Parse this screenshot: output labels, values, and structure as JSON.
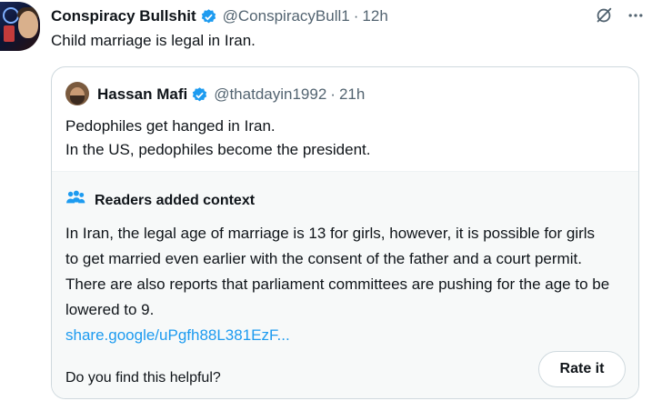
{
  "tweet": {
    "author_name": "Conspiracy Bullshit",
    "author_handle": "@ConspiracyBull1",
    "separator": "·",
    "time": "12h",
    "text": "Child marriage is legal in Iran.",
    "verified_color": "#1d9bf0"
  },
  "quoted": {
    "author_name": "Hassan Mafi",
    "author_handle": "@thatdayin1992",
    "separator": "·",
    "time": "21h",
    "text_line1": "Pedophiles get hanged in Iran.",
    "text_line2": "In the US, pedophiles become the president."
  },
  "context": {
    "title": "Readers added context",
    "body": "In Iran, the legal age of marriage is 13 for girls, however, it is possible for girls to get married even earlier with the consent of the father and a court permit. There are also reports that parliament committees are pushing for the age to be lowered to 9.",
    "link": "share.google/uPgfh88L381EzF...",
    "helpful_question": "Do you find this helpful?",
    "rate_label": "Rate it",
    "icon_color": "#1d9bf0"
  },
  "icons": {
    "grok": "grok-icon",
    "more": "more-icon",
    "verified": "verified-badge-icon",
    "people": "people-icon"
  }
}
